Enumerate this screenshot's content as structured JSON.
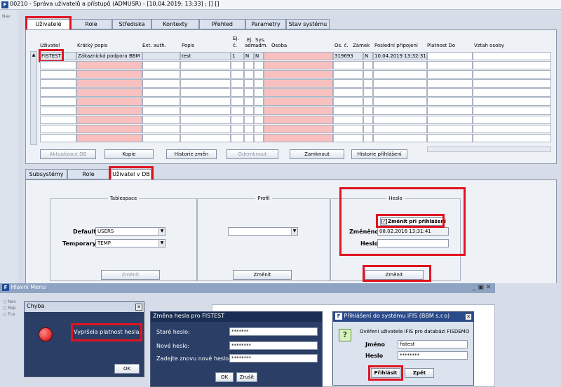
{
  "window": {
    "title": "00210 - Správa uživatelů a přístupů (ADMUSR) - [10.04.2019; 13:33] ; [] []",
    "icon": "F"
  },
  "nav_label": "Nav",
  "main_tabs": [
    "Uživatelé",
    "Role",
    "Střediska",
    "Kontexty",
    "Přehled",
    "Parametry",
    "Stav systému"
  ],
  "table": {
    "headers": {
      "uzivatel": "Uživatel",
      "kratky_popis": "Krátký popis",
      "ext_auth": "Ext. auth.",
      "popis": "Popis",
      "ej_c1": "Ej.",
      "ej_c2": "č.",
      "ej_adm1": "Ej.",
      "ej_adm2": "adm.",
      "sys_adm1": "Sys.",
      "sys_adm2": "adm.",
      "osoba": "Osoba",
      "os_c": "Os. č.",
      "zamek": "Zámek",
      "posledni": "Poslední připojení",
      "platnost": "Platnost Do",
      "vztah": "Vztah osoby"
    },
    "row1": {
      "uzivatel": "FISTEST",
      "kratky_popis": "Zákaznická podpora BBM",
      "ext_auth": "",
      "popis": "test",
      "ej_c": "1",
      "ej_adm": "N",
      "sys_adm": "N",
      "osoba": "",
      "os_c": "319693",
      "zamek": "N",
      "posledni": "10.04.2019 13:32:31",
      "platnost": "",
      "vztah": ""
    }
  },
  "buttons": {
    "aktualizace": "Aktualizace DB",
    "kopie": "Kopie",
    "historie_zmen": "Historie změn",
    "odemknout": "Odemknout",
    "zamknout": "Zamknout",
    "historie_prihlaseni": "Historie přihlášení"
  },
  "sub_tabs": [
    "Subsystémy",
    "Role",
    "Uživatel v DB"
  ],
  "tablespace": {
    "title": "Tablespace",
    "default_label": "Default",
    "default_value": "USERS",
    "temporary_label": "Temporary",
    "temporary_value": "TEMP",
    "button": "Změnit"
  },
  "profil": {
    "title": "Profil",
    "value": "",
    "button": "Změnit"
  },
  "heslo": {
    "title": "Heslo",
    "checkbox_label": "Změnit při přihlášení",
    "zmeneno_label": "Změněno",
    "zmeneno_value": "08.02.2016 13:31:41",
    "heslo_label": "Heslo",
    "heslo_value": "",
    "button": "Změnit"
  },
  "hlavni_menu": {
    "title": "Hlavní Menu",
    "icon": "F",
    "side": [
      "Nav",
      "Rep",
      "Fce"
    ]
  },
  "chyba": {
    "title": "Chyba",
    "message": "Vypršela platnost hesla.",
    "ok": "OK"
  },
  "zmena_hesla": {
    "title": "Změna hesla pro FISTEST",
    "stare_label": "Staré heslo:",
    "stare_value": "*******",
    "nove_label": "Nové heslo:",
    "nove_value": "********",
    "znovu_label": "Zadejte znovu nové heslo:",
    "znovu_value": "********",
    "ok": "OK",
    "zrusit": "Zrušit"
  },
  "prihlaseni": {
    "title": "Přihlášení do systému iFIS (BBM s.r.o)",
    "icon": "F",
    "message": "Ověření uživatele iFIS pro databázi FISDEMO",
    "jmeno_label": "Jméno",
    "jmeno_value": "fistest",
    "heslo_label": "Heslo",
    "heslo_value": "********",
    "prihlasit": "Přihlásit",
    "zpet": "Zpět"
  },
  "colors": {
    "highlight": "#e01421",
    "pink_cell": "#f9c0c0",
    "dialog_title": "#2a4a8a",
    "menu_title": "#8fa3c2"
  }
}
